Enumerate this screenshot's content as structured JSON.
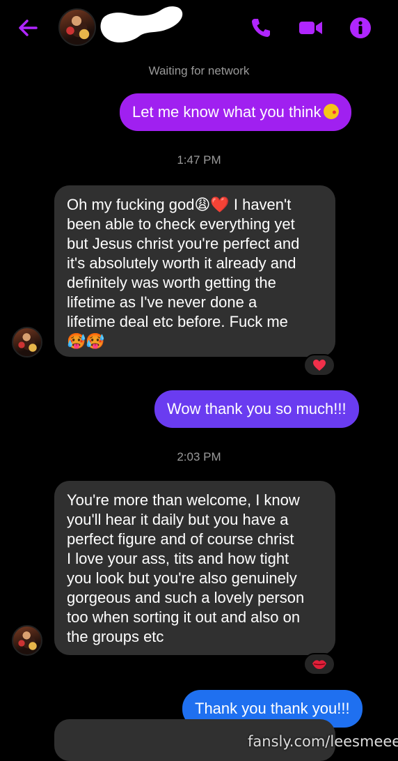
{
  "header": {
    "contact_name_redacted": true,
    "icons": [
      "back-arrow-icon",
      "phone-icon",
      "video-camera-icon",
      "info-icon"
    ],
    "accent_color": "#b026ff"
  },
  "status": "Waiting for network",
  "messages": [
    {
      "direction": "out",
      "text": "Let me know what you think",
      "emoji": "kissing-face-emoji",
      "color": "#a020f0"
    },
    {
      "type": "time",
      "text": "1:47 PM"
    },
    {
      "direction": "in",
      "text": "Oh my fucking god😩❤️ I haven't\nbeen able to check everything yet\nbut Jesus christ you're perfect and\nit's absolutely worth it already and\ndefinitely was worth getting the\nlifetime as I've never done a\nlifetime deal etc before. Fuck me\n🥵🥵",
      "reaction": "heart-reaction-icon"
    },
    {
      "direction": "out",
      "text": "Wow thank you so much!!!",
      "color": "#6a3cf0"
    },
    {
      "type": "time",
      "text": "2:03 PM"
    },
    {
      "direction": "in",
      "text": "You're more than welcome, I know\nyou'll hear it daily but you have a\nperfect figure and of course christ\nI love your ass, tits and how tight\nyou look but you're also genuinely\ngorgeous and such a lovely person\ntoo when sorting it out and also on\nthe groups etc",
      "reaction": "kiss-lips-reaction-icon"
    },
    {
      "direction": "out",
      "text": "Thank you thank you!!!",
      "color": "#1f70f0"
    }
  ],
  "watermark": "fansly.com/leesmeee"
}
